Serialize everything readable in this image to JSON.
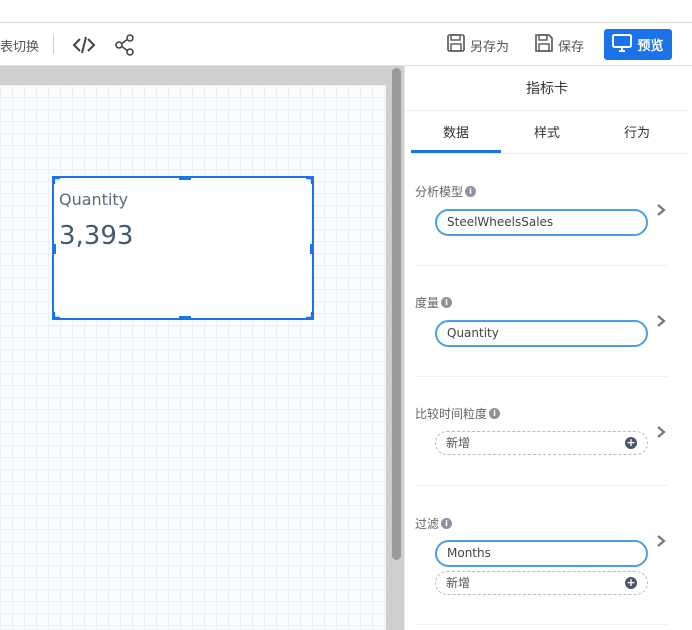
{
  "toolbar": {
    "left_text": "表切换",
    "save_as_label": "另存为",
    "save_label": "保存",
    "preview_label": "预览"
  },
  "widget": {
    "title": "Quantity",
    "value": "3,393"
  },
  "panel": {
    "title": "指标卡",
    "tabs": [
      "数据",
      "样式",
      "行为"
    ],
    "active_tab": 0,
    "sections": {
      "model": {
        "label": "分析模型",
        "value": "SteelWheelsSales"
      },
      "measure": {
        "label": "度量",
        "value": "Quantity"
      },
      "compare": {
        "label": "比较时间粒度",
        "add": "新增"
      },
      "filter": {
        "label": "过滤",
        "value": "Months",
        "add": "新增"
      }
    }
  },
  "colors": {
    "accent": "#1a73e8",
    "pill_border": "#4aa0e6"
  },
  "icons": [
    "code-icon",
    "share-icon",
    "save-as-icon",
    "save-icon",
    "monitor-icon",
    "info-icon",
    "plus-icon",
    "chevron-right-icon"
  ]
}
